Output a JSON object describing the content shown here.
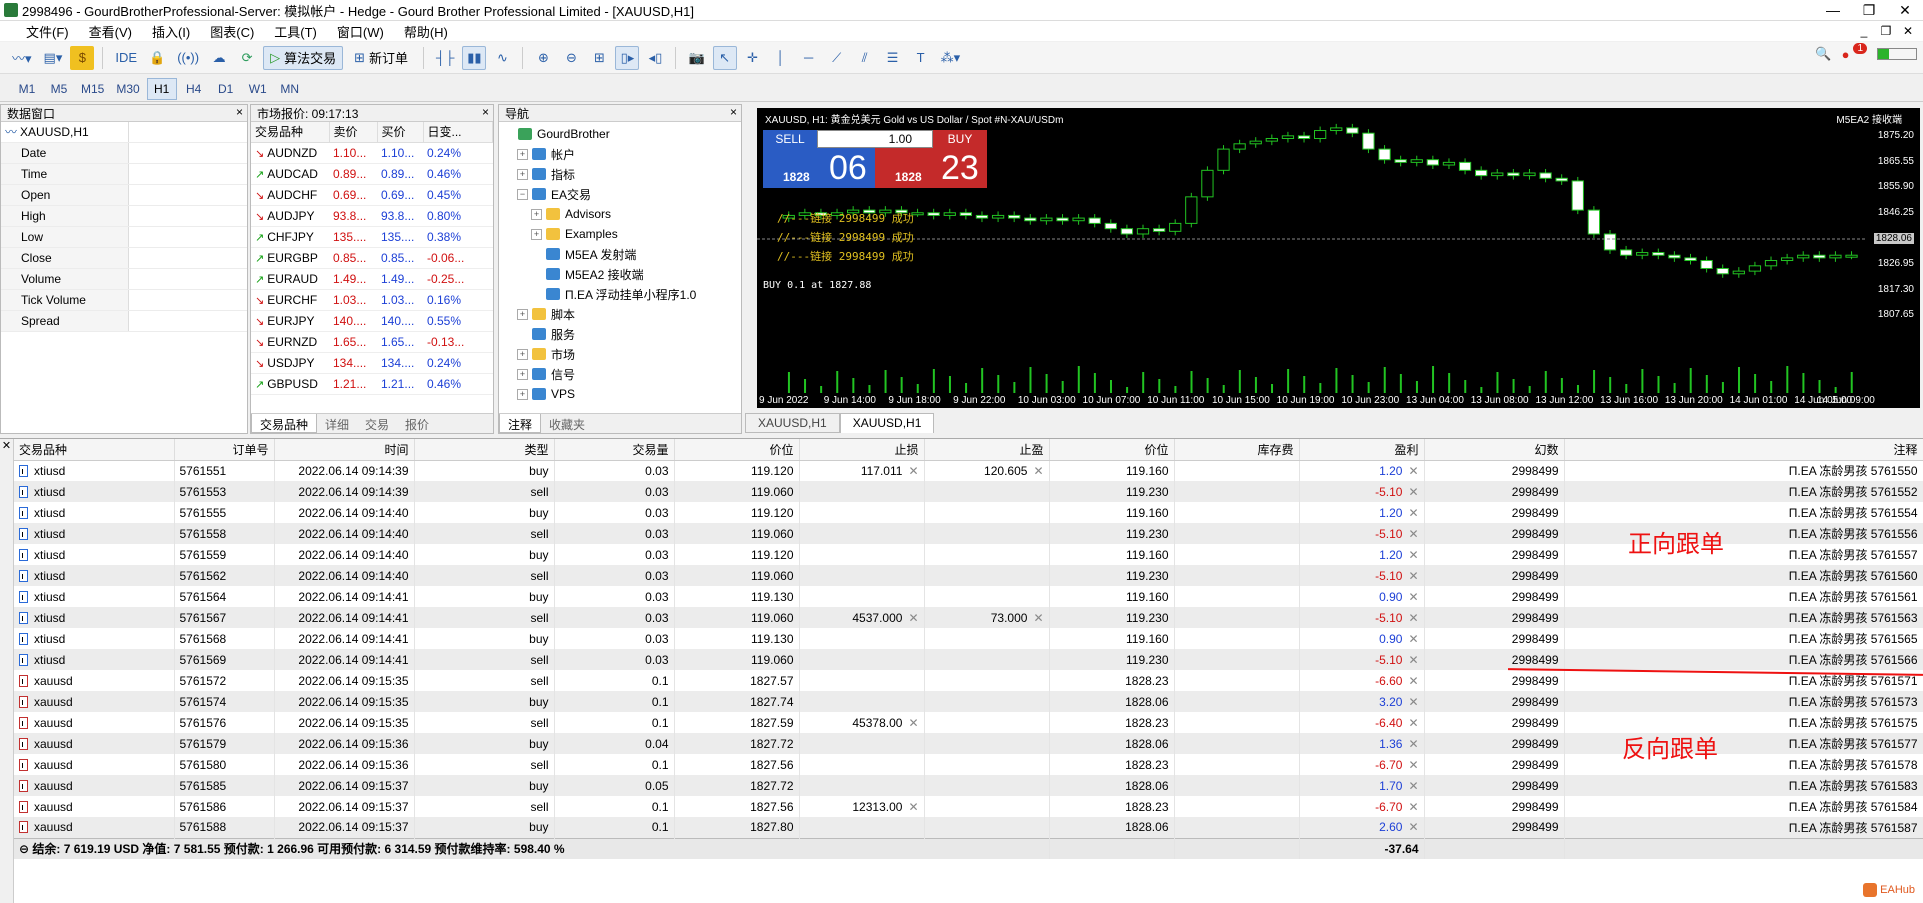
{
  "window": {
    "title": "2998496 - GourdBrotherProfessional-Server: 模拟帐户 - Hedge - Gourd Brother Professional Limited - [XAUUSD,H1]",
    "controls": [
      "—",
      "❐",
      "✕"
    ]
  },
  "menu": [
    "文件(F)",
    "查看(V)",
    "插入(I)",
    "图表(C)",
    "工具(T)",
    "窗口(W)",
    "帮助(H)"
  ],
  "toolbar": {
    "ide_label": "IDE",
    "algo_label": "算法交易",
    "new_order_label": "新订单",
    "notification_count": "1"
  },
  "timeframes": [
    "M1",
    "M5",
    "M15",
    "M30",
    "H1",
    "H4",
    "D1",
    "W1",
    "MN"
  ],
  "timeframe_active": "H1",
  "data_window": {
    "title": "数据窗口",
    "symbol": "XAUUSD,H1",
    "rows": [
      "Date",
      "Time",
      "Open",
      "High",
      "Low",
      "Close",
      "Volume",
      "Tick Volume",
      "Spread"
    ]
  },
  "market_watch": {
    "title": "市场报价: 09:17:13",
    "headers": [
      "交易品种",
      "卖价",
      "买价",
      "日变..."
    ],
    "rows": [
      {
        "sym": "AUDNZD",
        "bid": "1.10...",
        "ask": "1.10...",
        "chg": "0.24%",
        "dir": "down",
        "neg": false
      },
      {
        "sym": "AUDCAD",
        "bid": "0.89...",
        "ask": "0.89...",
        "chg": "0.46%",
        "dir": "up",
        "neg": false
      },
      {
        "sym": "AUDCHF",
        "bid": "0.69...",
        "ask": "0.69...",
        "chg": "0.45%",
        "dir": "down",
        "neg": false
      },
      {
        "sym": "AUDJPY",
        "bid": "93.8...",
        "ask": "93.8...",
        "chg": "0.80%",
        "dir": "down",
        "neg": false
      },
      {
        "sym": "CHFJPY",
        "bid": "135....",
        "ask": "135....",
        "chg": "0.38%",
        "dir": "up",
        "neg": false
      },
      {
        "sym": "EURGBP",
        "bid": "0.85...",
        "ask": "0.85...",
        "chg": "-0.06...",
        "dir": "up",
        "neg": true
      },
      {
        "sym": "EURAUD",
        "bid": "1.49...",
        "ask": "1.49...",
        "chg": "-0.25...",
        "dir": "up",
        "neg": true
      },
      {
        "sym": "EURCHF",
        "bid": "1.03...",
        "ask": "1.03...",
        "chg": "0.16%",
        "dir": "down",
        "neg": false
      },
      {
        "sym": "EURJPY",
        "bid": "140....",
        "ask": "140....",
        "chg": "0.55%",
        "dir": "down",
        "neg": false
      },
      {
        "sym": "EURNZD",
        "bid": "1.65...",
        "ask": "1.65...",
        "chg": "-0.13...",
        "dir": "down",
        "neg": true
      },
      {
        "sym": "USDJPY",
        "bid": "134....",
        "ask": "134....",
        "chg": "0.24%",
        "dir": "down",
        "neg": false
      },
      {
        "sym": "GBPUSD",
        "bid": "1.21...",
        "ask": "1.21...",
        "chg": "0.46%",
        "dir": "up",
        "neg": false
      }
    ],
    "tabs": [
      "交易品种",
      "详细",
      "交易",
      "报价"
    ]
  },
  "navigator": {
    "title": "导航",
    "items": [
      {
        "label": "GourdBrother",
        "level": 0,
        "icon": "green",
        "exp": ""
      },
      {
        "label": "帐户",
        "level": 1,
        "icon": "blue",
        "exp": "+"
      },
      {
        "label": "指标",
        "level": 1,
        "icon": "blue",
        "exp": "+"
      },
      {
        "label": "EA交易",
        "level": 1,
        "icon": "blue",
        "exp": "−"
      },
      {
        "label": "Advisors",
        "level": 2,
        "icon": "folder",
        "exp": "+"
      },
      {
        "label": "Examples",
        "level": 2,
        "icon": "folder",
        "exp": "+"
      },
      {
        "label": "M5EA 发射端",
        "level": 2,
        "icon": "blue",
        "exp": ""
      },
      {
        "label": "M5EA2 接收端",
        "level": 2,
        "icon": "blue",
        "exp": ""
      },
      {
        "label": "П.EA 浮动挂单小程序1.0",
        "level": 2,
        "icon": "blue",
        "exp": ""
      },
      {
        "label": "脚本",
        "level": 1,
        "icon": "folder",
        "exp": "+"
      },
      {
        "label": "服务",
        "level": 1,
        "icon": "blue",
        "exp": ""
      },
      {
        "label": "市场",
        "level": 1,
        "icon": "folder",
        "exp": "+"
      },
      {
        "label": "信号",
        "level": 1,
        "icon": "blue",
        "exp": "+"
      },
      {
        "label": "VPS",
        "level": 1,
        "icon": "blue",
        "exp": "+"
      }
    ],
    "tabs": [
      "注释",
      "收藏夹"
    ]
  },
  "chart": {
    "header": "XAUUSD, H1:  黄金兑美元 Gold vs US Dollar / Spot #N-XAU/USDm",
    "header_right": "M5EA2 接收端",
    "sell_label": "SELL",
    "buy_label": "BUY",
    "lot": "1.00",
    "bid_prefix": "1828",
    "bid_big": "06",
    "ask_prefix": "1828",
    "ask_big": "23",
    "status_lines": [
      "//---链接 2998499 成功",
      "//---链接 2998499 成功",
      "//---链接 2998499 成功"
    ],
    "line_label": "BUY 0.1 at 1827.88",
    "price_tag": "1828.06",
    "y_labels": [
      "1875.20",
      "1865.55",
      "1855.90",
      "1846.25",
      "1836.60",
      "1826.95",
      "1817.30",
      "1807.65"
    ],
    "x_labels": [
      "9 Jun 2022",
      "9 Jun 14:00",
      "9 Jun 18:00",
      "9 Jun 22:00",
      "10 Jun 03:00",
      "10 Jun 07:00",
      "10 Jun 11:00",
      "10 Jun 15:00",
      "10 Jun 19:00",
      "10 Jun 23:00",
      "13 Jun 04:00",
      "13 Jun 08:00",
      "13 Jun 12:00",
      "13 Jun 16:00",
      "13 Jun 20:00",
      "14 Jun 01:00",
      "14 Jun 05:00",
      "14 Jun 09:00"
    ],
    "tabs": [
      "XAUUSD,H1",
      "XAUUSD,H1"
    ],
    "colors": {
      "bull": "#22c422",
      "bear": "#ffffff",
      "sell": "#2a5cc4",
      "buy": "#c42a2a"
    }
  },
  "terminal": {
    "headers": [
      "交易品种",
      "订单号",
      "时间",
      "类型",
      "交易量",
      "价位",
      "止损",
      "止盈",
      "价位",
      "库存费",
      "盈利",
      "幻数",
      "注释"
    ],
    "rows": [
      {
        "sym": "xtiusd",
        "ticket": "5761551",
        "time": "2022.06.14 09:14:39",
        "type": "buy",
        "vol": "0.03",
        "open": "119.120",
        "sl": "117.011",
        "tp": "120.605",
        "cur": "119.160",
        "swap": "",
        "profit": "1.20",
        "magic": "2998499",
        "comment": "П.EA 冻龄男孩 5761550"
      },
      {
        "sym": "xtiusd",
        "ticket": "5761553",
        "time": "2022.06.14 09:14:39",
        "type": "sell",
        "vol": "0.03",
        "open": "119.060",
        "sl": "",
        "tp": "",
        "cur": "119.230",
        "swap": "",
        "profit": "-5.10",
        "magic": "2998499",
        "comment": "П.EA 冻龄男孩 5761552"
      },
      {
        "sym": "xtiusd",
        "ticket": "5761555",
        "time": "2022.06.14 09:14:40",
        "type": "buy",
        "vol": "0.03",
        "open": "119.120",
        "sl": "",
        "tp": "",
        "cur": "119.160",
        "swap": "",
        "profit": "1.20",
        "magic": "2998499",
        "comment": "П.EA 冻龄男孩 5761554"
      },
      {
        "sym": "xtiusd",
        "ticket": "5761558",
        "time": "2022.06.14 09:14:40",
        "type": "sell",
        "vol": "0.03",
        "open": "119.060",
        "sl": "",
        "tp": "",
        "cur": "119.230",
        "swap": "",
        "profit": "-5.10",
        "magic": "2998499",
        "comment": "П.EA 冻龄男孩 5761556"
      },
      {
        "sym": "xtiusd",
        "ticket": "5761559",
        "time": "2022.06.14 09:14:40",
        "type": "buy",
        "vol": "0.03",
        "open": "119.120",
        "sl": "",
        "tp": "",
        "cur": "119.160",
        "swap": "",
        "profit": "1.20",
        "magic": "2998499",
        "comment": "П.EA 冻龄男孩 5761557"
      },
      {
        "sym": "xtiusd",
        "ticket": "5761562",
        "time": "2022.06.14 09:14:40",
        "type": "sell",
        "vol": "0.03",
        "open": "119.060",
        "sl": "",
        "tp": "",
        "cur": "119.230",
        "swap": "",
        "profit": "-5.10",
        "magic": "2998499",
        "comment": "П.EA 冻龄男孩 5761560"
      },
      {
        "sym": "xtiusd",
        "ticket": "5761564",
        "time": "2022.06.14 09:14:41",
        "type": "buy",
        "vol": "0.03",
        "open": "119.130",
        "sl": "",
        "tp": "",
        "cur": "119.160",
        "swap": "",
        "profit": "0.90",
        "magic": "2998499",
        "comment": "П.EA 冻龄男孩 5761561"
      },
      {
        "sym": "xtiusd",
        "ticket": "5761567",
        "time": "2022.06.14 09:14:41",
        "type": "sell",
        "vol": "0.03",
        "open": "119.060",
        "sl": "4537.000",
        "tp": "73.000",
        "cur": "119.230",
        "swap": "",
        "profit": "-5.10",
        "magic": "2998499",
        "comment": "П.EA 冻龄男孩 5761563"
      },
      {
        "sym": "xtiusd",
        "ticket": "5761568",
        "time": "2022.06.14 09:14:41",
        "type": "buy",
        "vol": "0.03",
        "open": "119.130",
        "sl": "",
        "tp": "",
        "cur": "119.160",
        "swap": "",
        "profit": "0.90",
        "magic": "2998499",
        "comment": "П.EA 冻龄男孩 5761565"
      },
      {
        "sym": "xtiusd",
        "ticket": "5761569",
        "time": "2022.06.14 09:14:41",
        "type": "sell",
        "vol": "0.03",
        "open": "119.060",
        "sl": "",
        "tp": "",
        "cur": "119.230",
        "swap": "",
        "profit": "-5.10",
        "magic": "2998499",
        "comment": "П.EA 冻龄男孩 5761566"
      },
      {
        "sym": "xauusd",
        "ticket": "5761572",
        "time": "2022.06.14 09:15:35",
        "type": "sell",
        "vol": "0.1",
        "open": "1827.57",
        "sl": "",
        "tp": "",
        "cur": "1828.23",
        "swap": "",
        "profit": "-6.60",
        "magic": "2998499",
        "comment": "П.EA 冻龄男孩 5761571"
      },
      {
        "sym": "xauusd",
        "ticket": "5761574",
        "time": "2022.06.14 09:15:35",
        "type": "buy",
        "vol": "0.1",
        "open": "1827.74",
        "sl": "",
        "tp": "",
        "cur": "1828.06",
        "swap": "",
        "profit": "3.20",
        "magic": "2998499",
        "comment": "П.EA 冻龄男孩 5761573"
      },
      {
        "sym": "xauusd",
        "ticket": "5761576",
        "time": "2022.06.14 09:15:35",
        "type": "sell",
        "vol": "0.1",
        "open": "1827.59",
        "sl": "45378.00",
        "tp": "",
        "cur": "1828.23",
        "swap": "",
        "profit": "-6.40",
        "magic": "2998499",
        "comment": "П.EA 冻龄男孩 5761575"
      },
      {
        "sym": "xauusd",
        "ticket": "5761579",
        "time": "2022.06.14 09:15:36",
        "type": "buy",
        "vol": "0.04",
        "open": "1827.72",
        "sl": "",
        "tp": "",
        "cur": "1828.06",
        "swap": "",
        "profit": "1.36",
        "magic": "2998499",
        "comment": "П.EA 冻龄男孩 5761577"
      },
      {
        "sym": "xauusd",
        "ticket": "5761580",
        "time": "2022.06.14 09:15:36",
        "type": "sell",
        "vol": "0.1",
        "open": "1827.56",
        "sl": "",
        "tp": "",
        "cur": "1828.23",
        "swap": "",
        "profit": "-6.70",
        "magic": "2998499",
        "comment": "П.EA 冻龄男孩 5761578"
      },
      {
        "sym": "xauusd",
        "ticket": "5761585",
        "time": "2022.06.14 09:15:37",
        "type": "buy",
        "vol": "0.05",
        "open": "1827.72",
        "sl": "",
        "tp": "",
        "cur": "1828.06",
        "swap": "",
        "profit": "1.70",
        "magic": "2998499",
        "comment": "П.EA 冻龄男孩 5761583"
      },
      {
        "sym": "xauusd",
        "ticket": "5761586",
        "time": "2022.06.14 09:15:37",
        "type": "sell",
        "vol": "0.1",
        "open": "1827.56",
        "sl": "12313.00",
        "tp": "",
        "cur": "1828.23",
        "swap": "",
        "profit": "-6.70",
        "magic": "2998499",
        "comment": "П.EA 冻龄男孩 5761584"
      },
      {
        "sym": "xauusd",
        "ticket": "5761588",
        "time": "2022.06.14 09:15:37",
        "type": "buy",
        "vol": "0.1",
        "open": "1827.80",
        "sl": "",
        "tp": "",
        "cur": "1828.06",
        "swap": "",
        "profit": "2.60",
        "magic": "2998499",
        "comment": "П.EA 冻龄男孩 5761587"
      }
    ],
    "summary": "结余: 7 619.19 USD  净值: 7 581.55  预付款: 1 266.96  可用预付款: 6 314.59  预付款维持率: 598.40 %",
    "summary_profit": "-37.64",
    "side_label": "✕"
  },
  "annotations": {
    "forward": "正向跟单",
    "reverse": "反向跟单",
    "color": "#ee1111"
  },
  "watermark": "EAHub"
}
